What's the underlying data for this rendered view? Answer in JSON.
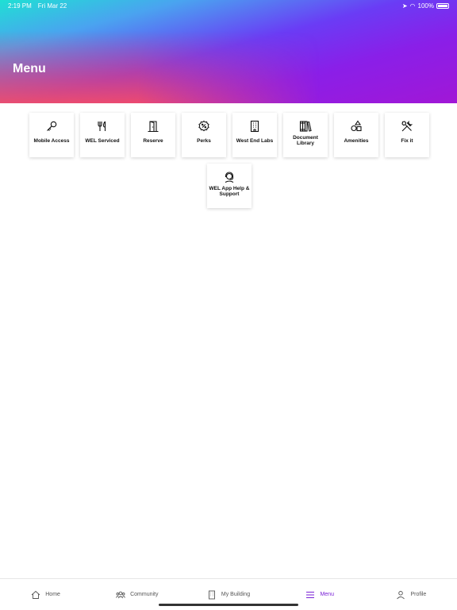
{
  "status_bar": {
    "time": "2:19 PM",
    "date": "Fri Mar 22",
    "battery": "100%"
  },
  "header": {
    "title": "Menu"
  },
  "menu_items": [
    {
      "label": "Mobile Access",
      "icon": "key-icon"
    },
    {
      "label": "WEL Serviced",
      "icon": "fork-knife-icon"
    },
    {
      "label": "Reserve",
      "icon": "door-icon"
    },
    {
      "label": "Perks",
      "icon": "percent-badge-icon"
    },
    {
      "label": "West End Labs",
      "icon": "building-icon"
    },
    {
      "label": "Document Library",
      "icon": "books-icon"
    },
    {
      "label": "Amenities",
      "icon": "shapes-icon"
    },
    {
      "label": "Fix it",
      "icon": "tools-icon"
    },
    {
      "label": "WEL App Help & Support",
      "icon": "headset-icon"
    }
  ],
  "tab_bar": {
    "home": "Home",
    "community": "Community",
    "my_building": "My Building",
    "menu": "Menu",
    "profile": "Profile",
    "active": "menu",
    "active_color": "#7a22d6"
  }
}
